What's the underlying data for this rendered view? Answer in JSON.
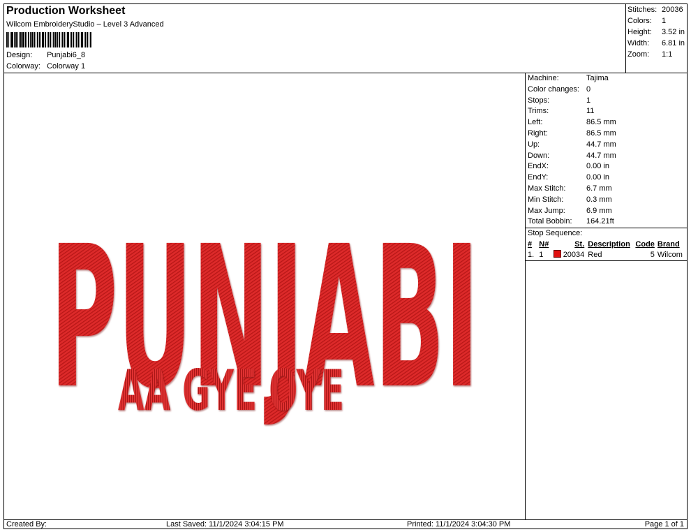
{
  "header": {
    "title": "Production Worksheet",
    "subtitle": "Wilcom EmbroideryStudio – Level 3 Advanced",
    "design_label": "Design:",
    "design_value": "Punjabi6_8",
    "colorway_label": "Colorway:",
    "colorway_value": "Colorway 1"
  },
  "stats": [
    {
      "label": "Stitches:",
      "value": "20036"
    },
    {
      "label": "Colors:",
      "value": "1"
    },
    {
      "label": "Height:",
      "value": "3.52 in"
    },
    {
      "label": "Width:",
      "value": "6.81 in"
    },
    {
      "label": "Zoom:",
      "value": "1:1"
    }
  ],
  "design": {
    "main_text": "PUNJABI",
    "sub_text": "AA GYE OYE",
    "thread_color": "#dd2a2a"
  },
  "machine_info": [
    {
      "label": "Machine:",
      "value": "Tajima"
    },
    {
      "label": "Color changes:",
      "value": "0"
    },
    {
      "label": "Stops:",
      "value": "1"
    },
    {
      "label": "Trims:",
      "value": "11"
    },
    {
      "label": "Left:",
      "value": "86.5 mm"
    },
    {
      "label": "Right:",
      "value": "86.5 mm"
    },
    {
      "label": "Up:",
      "value": "44.7 mm"
    },
    {
      "label": "Down:",
      "value": "44.7 mm"
    },
    {
      "label": "EndX:",
      "value": "0.00 in"
    },
    {
      "label": "EndY:",
      "value": "0.00 in"
    },
    {
      "label": "Max Stitch:",
      "value": "6.7 mm"
    },
    {
      "label": "Min Stitch:",
      "value": "0.3 mm"
    },
    {
      "label": "Max Jump:",
      "value": "6.9 mm"
    },
    {
      "label": "Total Bobbin:",
      "value": "164.21ft"
    }
  ],
  "stop_sequence": {
    "title": "Stop Sequence:",
    "columns": {
      "num": "#",
      "n": "N#",
      "st": "St.",
      "desc": "Description",
      "code": "Code",
      "brand": "Brand"
    },
    "rows": [
      {
        "num": "1.",
        "n": "1",
        "color": "#e01010",
        "st": "20034",
        "desc": "Red",
        "code": "5",
        "brand": "Wilcom"
      }
    ]
  },
  "footer": {
    "created_by": "Created By:",
    "last_saved": "Last Saved: 11/1/2024 3:04:15 PM",
    "printed": "Printed: 11/1/2024 3:04:30 PM",
    "page": "Page 1 of 1"
  }
}
